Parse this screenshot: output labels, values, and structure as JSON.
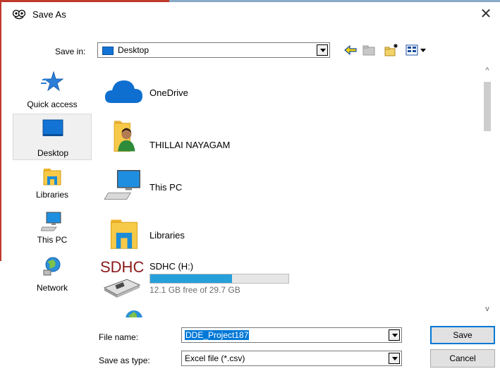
{
  "window": {
    "title": "Save As",
    "close_glyph": "✕"
  },
  "save_in": {
    "label": "Save in:",
    "value": "Desktop"
  },
  "places": [
    {
      "label": "Quick access",
      "icon": "star-icon"
    },
    {
      "label": "Desktop",
      "icon": "desktop-icon",
      "selected": true
    },
    {
      "label": "Libraries",
      "icon": "libraries-icon"
    },
    {
      "label": "This PC",
      "icon": "computer-icon"
    },
    {
      "label": "Network",
      "icon": "network-icon"
    }
  ],
  "files": [
    {
      "name": "OneDrive",
      "icon": "onedrive-icon"
    },
    {
      "name": "THILLAI NAYAGAM",
      "icon": "user-folder-icon"
    },
    {
      "name": "This PC",
      "icon": "computer-icon"
    },
    {
      "name": "Libraries",
      "icon": "libraries-icon"
    },
    {
      "name": "SDHC (H:)",
      "icon": "sd-card-drive-icon",
      "logo_text": "SDHC",
      "free_text": "12.1 GB free of 29.7 GB",
      "used_fraction": 0.59
    }
  ],
  "file_name": {
    "label": "File name:",
    "value": "DDE_Project187"
  },
  "save_type": {
    "label": "Save as type:",
    "value": "Excel file (*.csv)"
  },
  "buttons": {
    "save": "Save",
    "cancel": "Cancel"
  },
  "scroll": {
    "up": "^",
    "down": "v"
  },
  "colors": {
    "selection": "#0078d7",
    "drive_bar": "#26a0da",
    "accent_blue": "#1273d4"
  }
}
